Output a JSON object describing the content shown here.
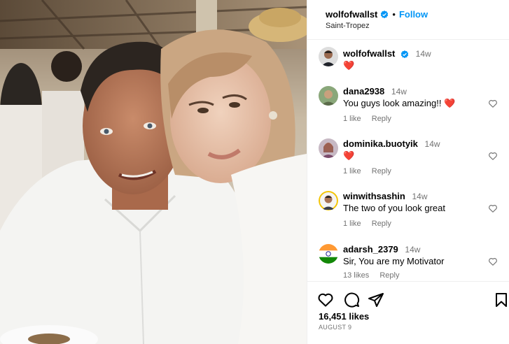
{
  "post": {
    "username": "wolfofwallst",
    "follow_label": "Follow",
    "separator": "•",
    "location": "Saint-Tropez",
    "likes": "16,451 likes",
    "date": "AUGUST 9"
  },
  "caption": {
    "username": "wolfofwallst",
    "time": "14w",
    "text": "❤️"
  },
  "comments": [
    {
      "username": "dana2938",
      "time": "14w",
      "text": "You guys look amazing!! ❤️",
      "likes": "1 like",
      "reply": "Reply"
    },
    {
      "username": "dominika.buotyik",
      "time": "14w",
      "text": "❤️",
      "likes": "1 like",
      "reply": "Reply"
    },
    {
      "username": "winwithsashin",
      "time": "14w",
      "text": "The two of you look great",
      "likes": "1 like",
      "reply": "Reply"
    },
    {
      "username": "adarsh_2379",
      "time": "14w",
      "text": "Sir, You are my Motivator",
      "likes": "13 likes",
      "reply": "Reply"
    }
  ],
  "icons": {
    "like": "heart-outline-icon",
    "comment": "comment-bubble-icon",
    "share": "paper-plane-icon",
    "save": "bookmark-icon",
    "verified": "verified-badge-icon"
  },
  "colors": {
    "link": "#0095f6",
    "verified": "#0095f6",
    "heart": "#ed4956",
    "muted": "#737373"
  }
}
